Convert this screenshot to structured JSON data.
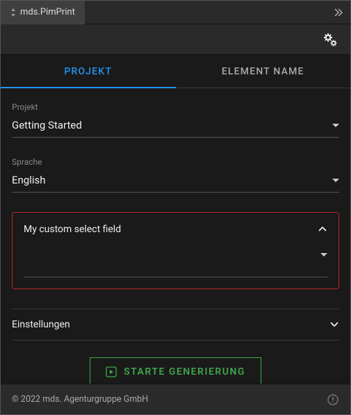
{
  "titlebar": {
    "title": "mds.PimPrint"
  },
  "tabs": {
    "projekt": "PROJEKT",
    "element": "ELEMENT NAME"
  },
  "fields": {
    "projekt": {
      "label": "Projekt",
      "value": "Getting Started"
    },
    "sprache": {
      "label": "Sprache",
      "value": "English"
    }
  },
  "custom": {
    "title": "My custom select field",
    "value": ""
  },
  "settings": {
    "label": "Einstellungen"
  },
  "actions": {
    "generate": "STARTE GENERIERUNG"
  },
  "footer": {
    "copyright": "© 2022 mds. Agenturgruppe GmbH"
  }
}
